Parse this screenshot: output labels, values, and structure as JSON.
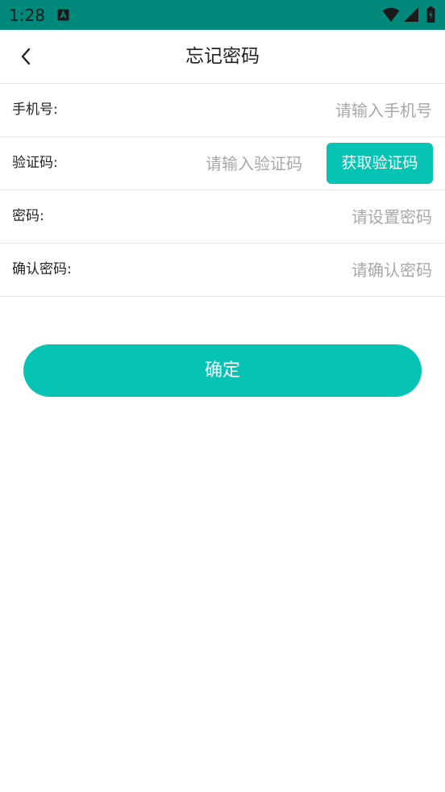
{
  "status_bar": {
    "time": "1:28",
    "notification_icon": "a-letter-icon",
    "icons": [
      "wifi-icon",
      "signal-icon",
      "battery-icon"
    ],
    "color": "#00897b"
  },
  "app_bar": {
    "back_icon": "chevron-left-icon",
    "title": "忘记密码"
  },
  "form": {
    "phone": {
      "label": "手机号:",
      "placeholder": "请输入手机号",
      "value": ""
    },
    "code": {
      "label": "验证码:",
      "placeholder": "请输入验证码",
      "value": "",
      "button_label": "获取验证码"
    },
    "password": {
      "label": "密码:",
      "placeholder": "请设置密码",
      "value": ""
    },
    "confirm_password": {
      "label": "确认密码:",
      "placeholder": "请确认密码",
      "value": ""
    }
  },
  "confirm_button": {
    "label": "确定"
  },
  "colors": {
    "accent": "#07c3b4",
    "status_bar": "#00897b",
    "placeholder": "#a8a8a8",
    "divider": "#e8e8e8"
  }
}
